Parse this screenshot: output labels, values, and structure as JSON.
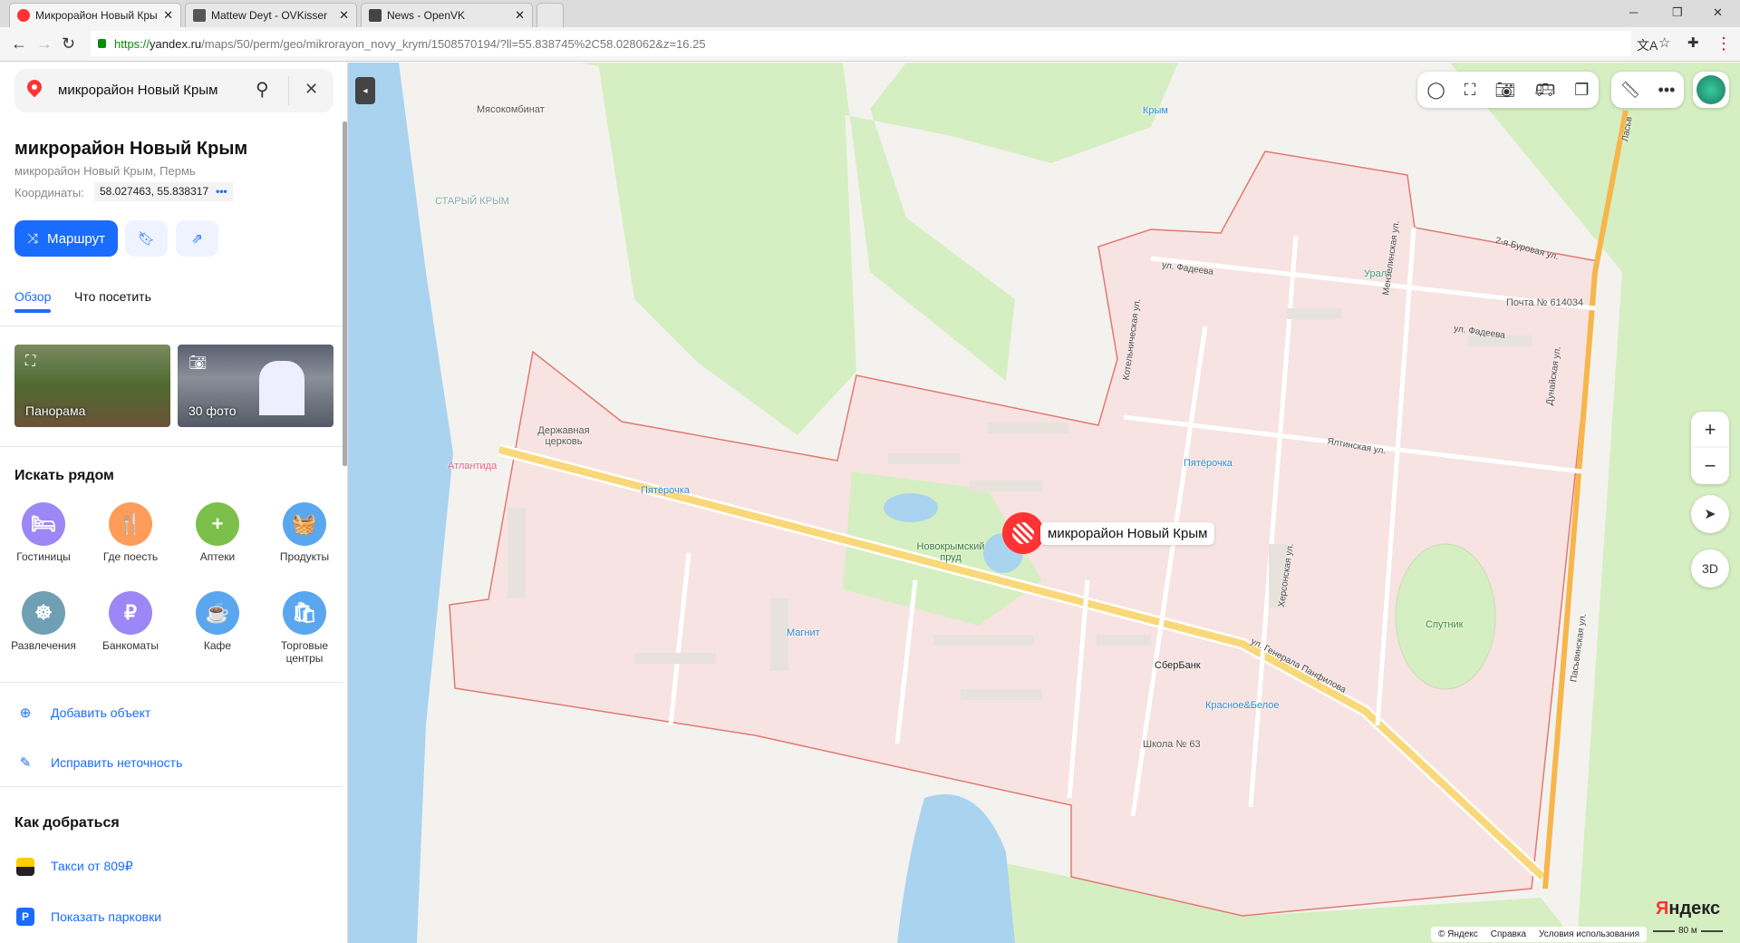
{
  "browser": {
    "tabs": [
      {
        "title": "Микрорайон Новый Кры",
        "active": true
      },
      {
        "title": "Mattew Deyt - OVKisser"
      },
      {
        "title": "News - OpenVK"
      }
    ],
    "url_scheme": "https://",
    "url_domain": "yandex.ru",
    "url_path": "/maps/50/perm/geo/mikrorayon_novy_krym/1508570194/?ll=55.838745%2C58.028062&z=16.25"
  },
  "sidebar": {
    "search_value": "микрорайон Новый Крым",
    "title": "микрорайон Новый Крым",
    "subtitle": "микрорайон Новый Крым, Пермь",
    "coords_label": "Координаты:",
    "coords": "58.027463, 55.838317",
    "route_label": "Маршрут",
    "tabs": [
      "Обзор",
      "Что посетить"
    ],
    "panorama_label": "Панорама",
    "photos_label": "30 фото",
    "nearby_title": "Искать рядом",
    "nearby": [
      {
        "label": "Гостиницы",
        "color": "#9b87f5",
        "icon": "🛏"
      },
      {
        "label": "Где поесть",
        "color": "#ff9c5a",
        "icon": "🍴"
      },
      {
        "label": "Аптеки",
        "color": "#7cc04b",
        "icon": "+"
      },
      {
        "label": "Продукты",
        "color": "#5aa7f0",
        "icon": "🧺"
      },
      {
        "label": "Развлечения",
        "color": "#6e9fb5",
        "icon": "☸"
      },
      {
        "label": "Банкоматы",
        "color": "#9b87f5",
        "icon": "₽"
      },
      {
        "label": "Кафе",
        "color": "#5aa7f0",
        "icon": "☕"
      },
      {
        "label": "Торговые центры",
        "color": "#5aa7f0",
        "icon": "🛍"
      }
    ],
    "add_object": "Добавить объект",
    "fix_error": "Исправить неточность",
    "directions_title": "Как добраться",
    "taxi": "Такси от 809₽",
    "parking": "Показать парковки"
  },
  "map": {
    "marker_label": "микрорайон Новый Крым",
    "labels": {
      "meat": "Мясокомбинат",
      "krym": "Крым",
      "old_krym": "СТАРЫЙ КРЫМ",
      "church": "Державная церковь",
      "atlantida": "Атлантида",
      "pyat1": "Пятёрочка",
      "pond": "Новокрымский пруд",
      "magnit": "Магнит",
      "pyat2": "Пятёрочка",
      "ural": "Урал",
      "post": "Почта № 614034",
      "sber": "СберБанк",
      "kb": "Красное&Белое",
      "school": "Школа № 63",
      "sputnik": "Спутник",
      "fadeeva1": "ул. Фадеева",
      "burovaya": "2-я Буровая ул.",
      "fadeeva2": "ул. Фадеева",
      "yalta": "Ялтинская ул.",
      "panfilova": "ул. Генерала Панфилова",
      "kherson": "Херсонская ул.",
      "pasvin": "Пасьвинская ул.",
      "kotel": "Котельническая ул.",
      "menzel": "Мензелинская ул.",
      "dunai": "Дунайская ул.",
      "lasv": "Ласьв"
    },
    "zoom_in": "+",
    "zoom_out": "−",
    "btn_3d": "3D",
    "copyright": "© Яндекс",
    "help": "Справка",
    "terms": "Условия использования",
    "logo_a": "Я",
    "logo_b": "ндекс",
    "scale": "80 м"
  }
}
